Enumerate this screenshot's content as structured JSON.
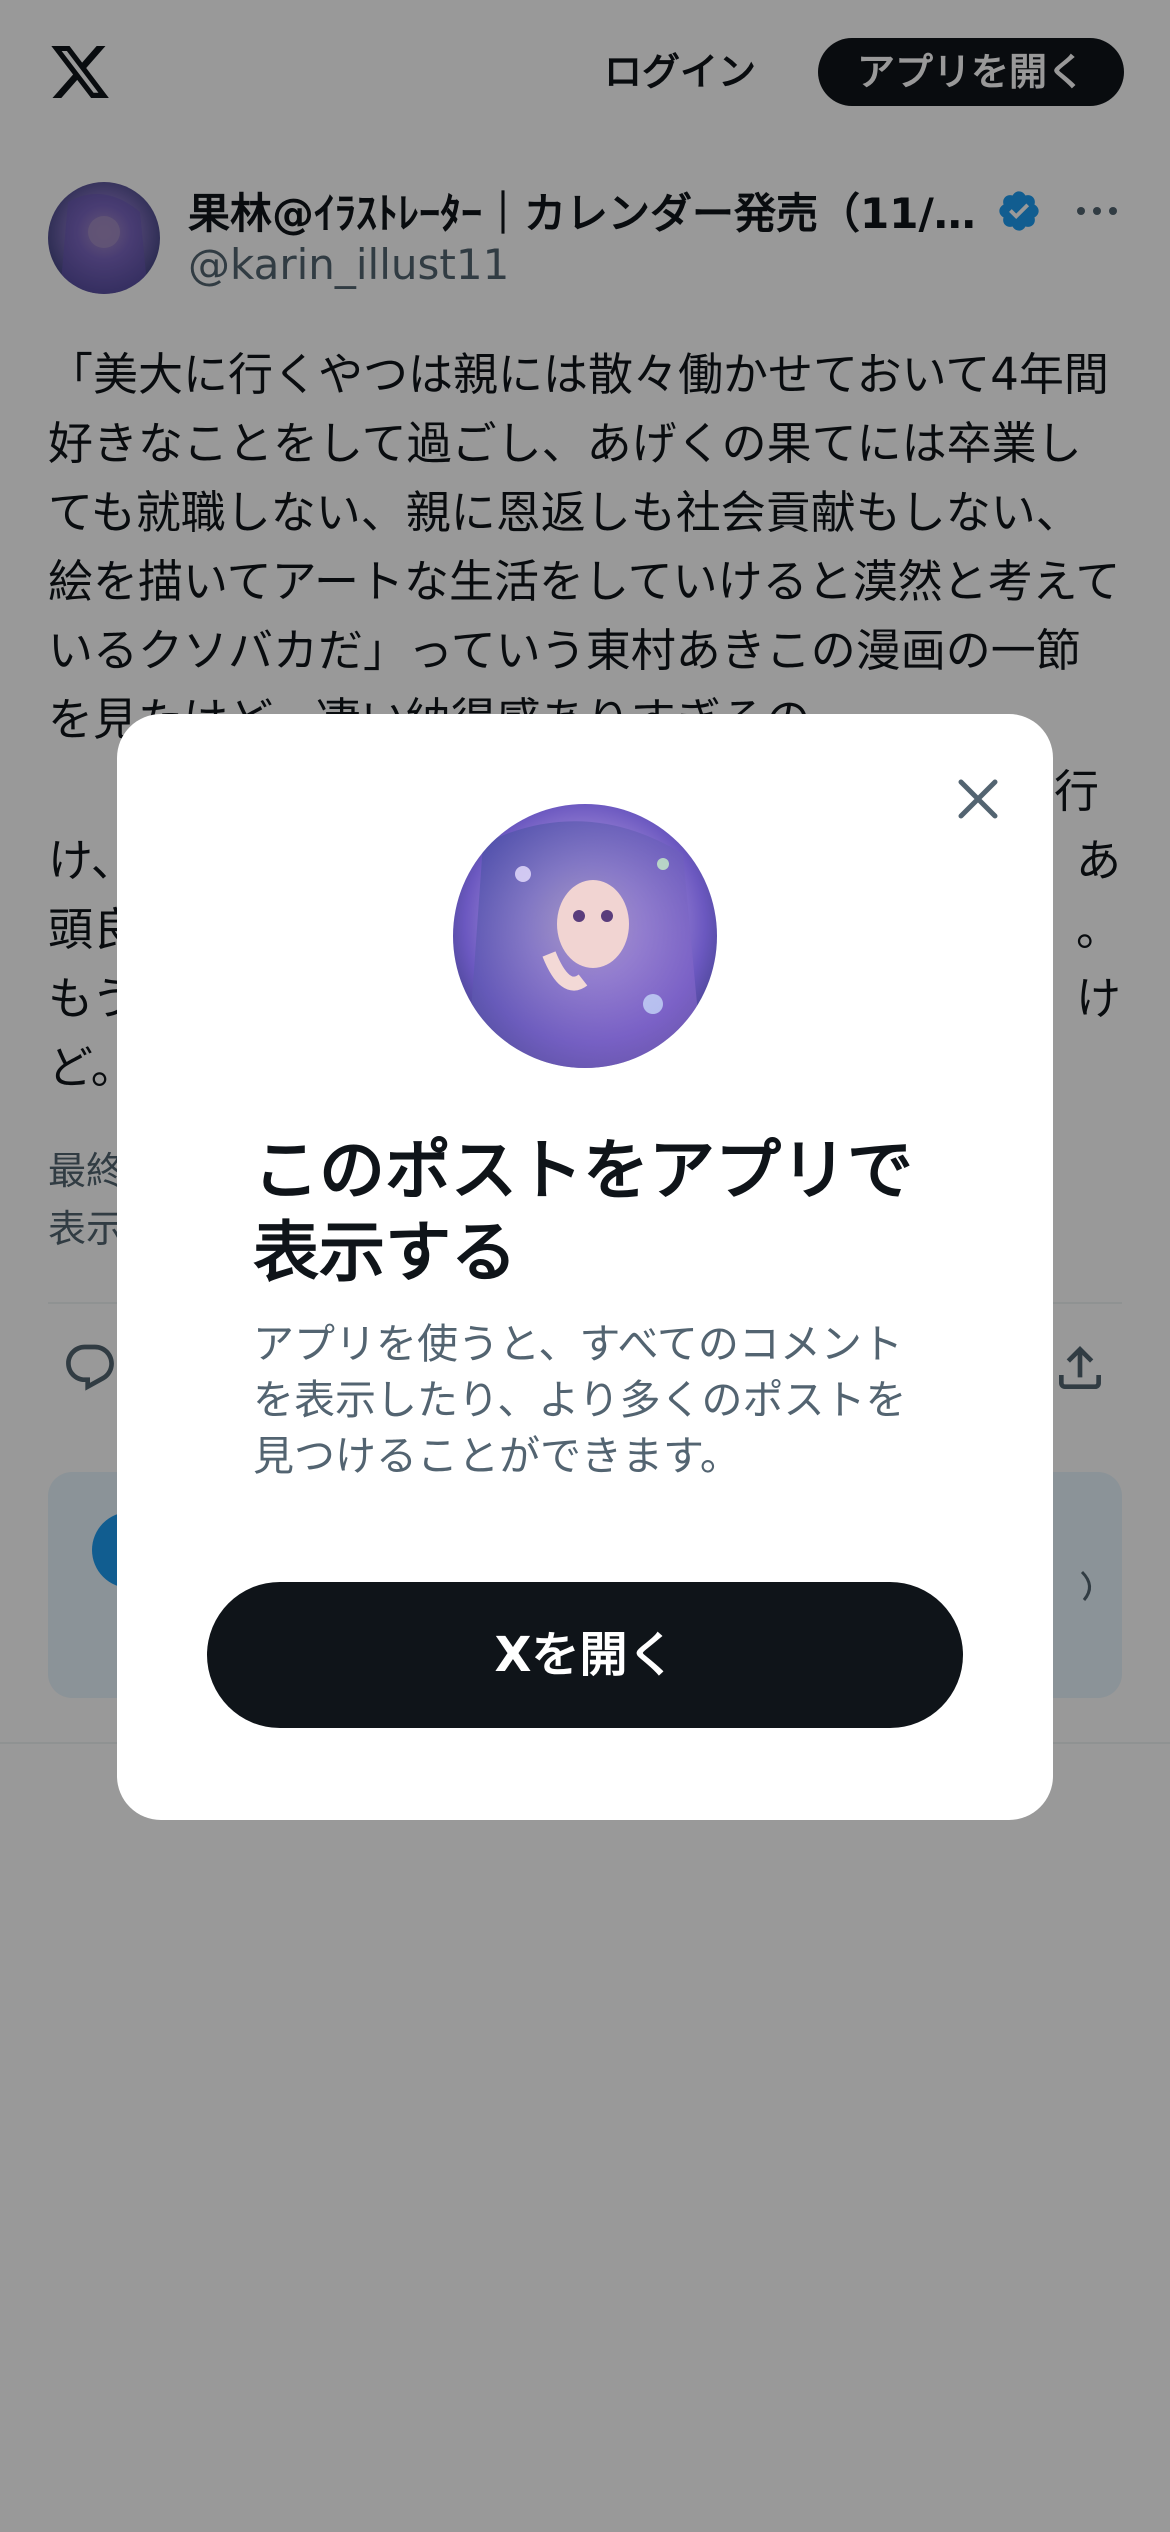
{
  "header": {
    "logo": "x-logo",
    "login_label": "ログイン",
    "open_app_label": "アプリを開く"
  },
  "post": {
    "display_name": "果林@ｲﾗｽﾄﾚｰﾀｰ｜カレンダー発売（11/1...",
    "handle": "@karin_illust11",
    "verified": true,
    "text": "「美大に行くやつは親には散々働かせておいて4年間好きなことをして過ごし、あげくの果てには卒業しても就職しない、親に恩返しも社会貢献もしない、絵を描いてアートな生活をしていけると漠然と考えているクソバカだ」っていう東村あきこの漫画の一節を見たけど、凄い納得感ありすぎるの",
    "text_tail_lines": [
      "行",
      "け、",
      "あ",
      "頭良",
      "。",
      "もう",
      "け",
      "ど。"
    ],
    "meta_line1": "最終",
    "meta_line2": "表示"
  },
  "modal": {
    "title": "このポストをアプリで表示する",
    "description": "アプリを使うと、すべてのコメントを表示したり、より多くのポストを見つけることができます。",
    "button_label": "Xを開く"
  },
  "colors": {
    "text_primary": "#0f1419",
    "text_secondary": "#536471",
    "verified_blue": "#1d9bf0",
    "button_dark": "#0f1419",
    "overlay": "rgba(0,0,0,0.40)"
  }
}
